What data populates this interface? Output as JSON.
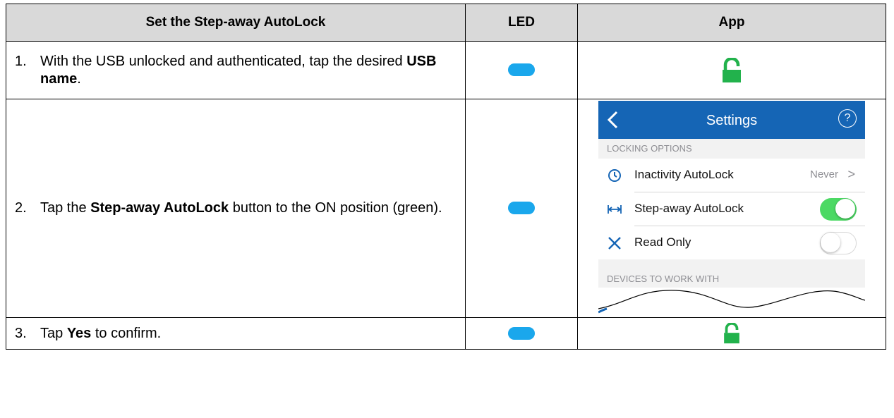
{
  "table": {
    "headers": {
      "step": "Set the Step-away AutoLock",
      "led": "LED",
      "app": "App"
    },
    "rows": [
      {
        "num": "1.",
        "text_before": "With the USB unlocked and authenticated, tap the desired ",
        "bold": "USB name",
        "text_after": ".",
        "led_color": "#1aa7ec",
        "app_icon": "unlocked-padlock-icon"
      },
      {
        "num": "2.",
        "text_before": "Tap the ",
        "bold": "Step-away AutoLock",
        "text_after": " button to the ON position (green).",
        "led_color": "#1aa7ec",
        "app_icon": "settings-screenshot"
      },
      {
        "num": "3.",
        "text_before": "Tap ",
        "bold": "Yes",
        "text_after": " to confirm.",
        "led_color": "#1aa7ec",
        "app_icon": "unlocked-padlock-icon"
      }
    ]
  },
  "phone": {
    "title": "Settings",
    "help_glyph": "?",
    "section_locking": "LOCKING OPTIONS",
    "inactivity_label": "Inactivity AutoLock",
    "inactivity_value": "Never",
    "chevron": ">",
    "stepaway_label": "Step-away AutoLock",
    "stepaway_on": true,
    "readonly_label": "Read Only",
    "readonly_on": false,
    "section_devices": "DEVICES TO WORK WITH"
  },
  "colors": {
    "led": "#1aa7ec",
    "lock": "#22b24c",
    "header_blue": "#1565b5",
    "toggle_on": "#4cd964"
  }
}
